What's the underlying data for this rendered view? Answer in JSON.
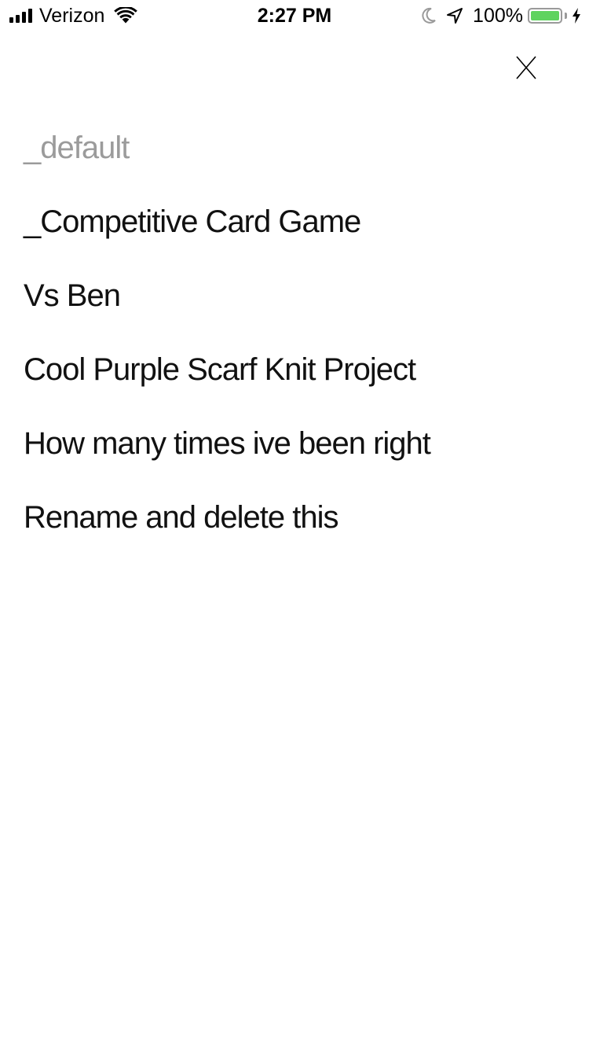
{
  "status_bar": {
    "carrier": "Verizon",
    "time": "2:27 PM",
    "battery_percent": "100%",
    "battery_level": 1.0,
    "icons": [
      "cellular-signal-icon",
      "wifi-icon",
      "moon-icon",
      "location-arrow-icon",
      "battery-icon",
      "charging-bolt-icon"
    ]
  },
  "close_icon": "close-icon",
  "list": {
    "items": [
      {
        "label": "_default",
        "muted": true
      },
      {
        "label": "_Competitive Card Game",
        "muted": false
      },
      {
        "label": "Vs Ben",
        "muted": false
      },
      {
        "label": "Cool Purple Scarf Knit Project",
        "muted": false
      },
      {
        "label": "How many times ive been right",
        "muted": false
      },
      {
        "label": "Rename and delete this",
        "muted": false
      }
    ]
  },
  "colors": {
    "muted_text": "#9b9b9b",
    "text": "#111111",
    "battery_fill": "#5fd35f",
    "background": "#ffffff"
  }
}
